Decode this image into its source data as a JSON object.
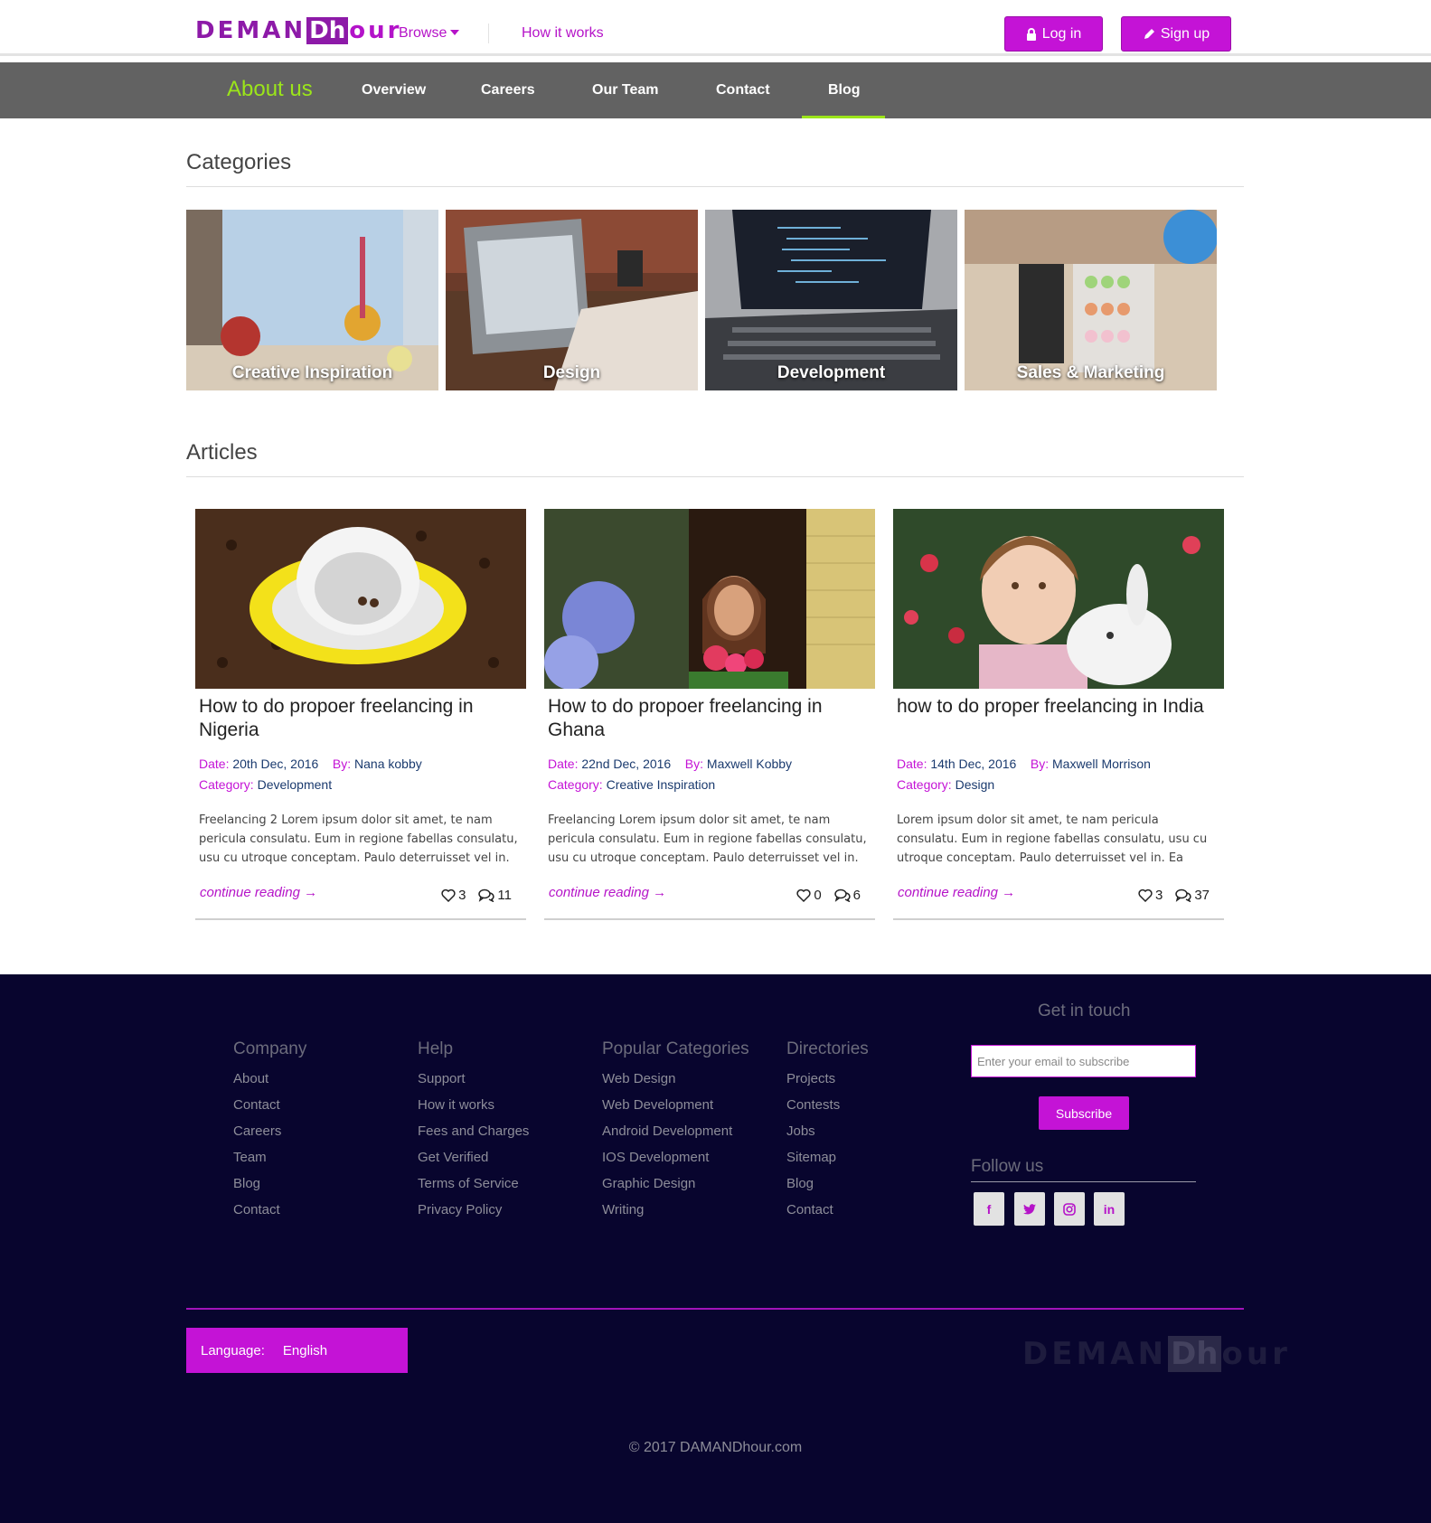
{
  "header": {
    "logo": {
      "part1": "DEMAN",
      "part2": "Dh",
      "part3": "our"
    },
    "nav": {
      "browse": "Browse",
      "how_it_works": "How it works"
    },
    "login": "Log in",
    "signup": "Sign up",
    "brand_color": "#c413d6"
  },
  "about_nav": {
    "title": "About us",
    "items": [
      "Overview",
      "Careers",
      "Our Team",
      "Contact",
      "Blog"
    ],
    "active": "Blog",
    "accent_color": "#9be51a"
  },
  "categories": {
    "heading": "Categories",
    "items": [
      {
        "label": "Creative Inspiration"
      },
      {
        "label": "Design"
      },
      {
        "label": "Development"
      },
      {
        "label": "Sales & Marketing"
      }
    ]
  },
  "articles": {
    "heading": "Articles",
    "date_key": "Date:",
    "by_key": "By:",
    "category_key": "Category:",
    "more_label": "continue reading →",
    "items": [
      {
        "title": "How to do propoer freelancing in Nigeria",
        "date": "20th Dec, 2016",
        "author": "Nana kobby",
        "category": "Development",
        "excerpt": "Freelancing 2 Lorem ipsum dolor sit amet, te nam pericula consulatu. Eum in regione fabellas consulatu, usu cu utroque conceptam. Paulo deterruisset vel in. Ea",
        "likes": "3",
        "comments": "11"
      },
      {
        "title": "How to do propoer freelancing in Ghana",
        "date": "22nd Dec, 2016",
        "author": "Maxwell Kobby",
        "category": "Creative Inspiration",
        "excerpt": "Freelancing Lorem ipsum dolor sit amet, te nam pericula consulatu. Eum in regione fabellas consulatu, usu cu utroque conceptam. Paulo deterruisset vel in. Ea",
        "likes": "0",
        "comments": "6"
      },
      {
        "title": "how to do proper freelancing in India",
        "date": "14th Dec, 2016",
        "author": "Maxwell Morrison",
        "category": "Design",
        "excerpt": "Lorem ipsum dolor sit amet, te nam pericula consulatu. Eum in regione fabellas consulatu, usu cu utroque conceptam. Paulo deterruisset vel in. Ea modo dicat vix,",
        "likes": "3",
        "comments": "37"
      }
    ]
  },
  "footer": {
    "columns": [
      {
        "heading": "Company",
        "links": [
          "About",
          "Contact",
          "Careers",
          "Team",
          "Blog",
          "Contact"
        ]
      },
      {
        "heading": "Help",
        "links": [
          "Support",
          "How it works",
          "Fees and Charges",
          "Get Verified",
          "Terms of Service",
          "Privacy Policy"
        ]
      },
      {
        "heading": "Popular Categories",
        "links": [
          "Web Design",
          "Web Development",
          "Android Development",
          "IOS Development",
          "Graphic Design",
          "Writing"
        ]
      },
      {
        "heading": "Directories",
        "links": [
          "Projects",
          "Contests",
          "Jobs",
          "Sitemap",
          "Blog",
          "Contact"
        ]
      }
    ],
    "get_in_touch": "Get in touch",
    "email_placeholder": "Enter your email to subscribe",
    "subscribe": "Subscribe",
    "follow_us": "Follow us",
    "social_icons": [
      "facebook-icon",
      "twitter-icon",
      "instagram-icon",
      "linkedin-icon"
    ],
    "language_label": "Language:",
    "language_value": "English",
    "logo": {
      "part1": "DEMAN",
      "part2": "Dh",
      "part3": "our"
    },
    "copyright": "© 2017 DAMANDhour.com",
    "background_color": "#08052e"
  }
}
